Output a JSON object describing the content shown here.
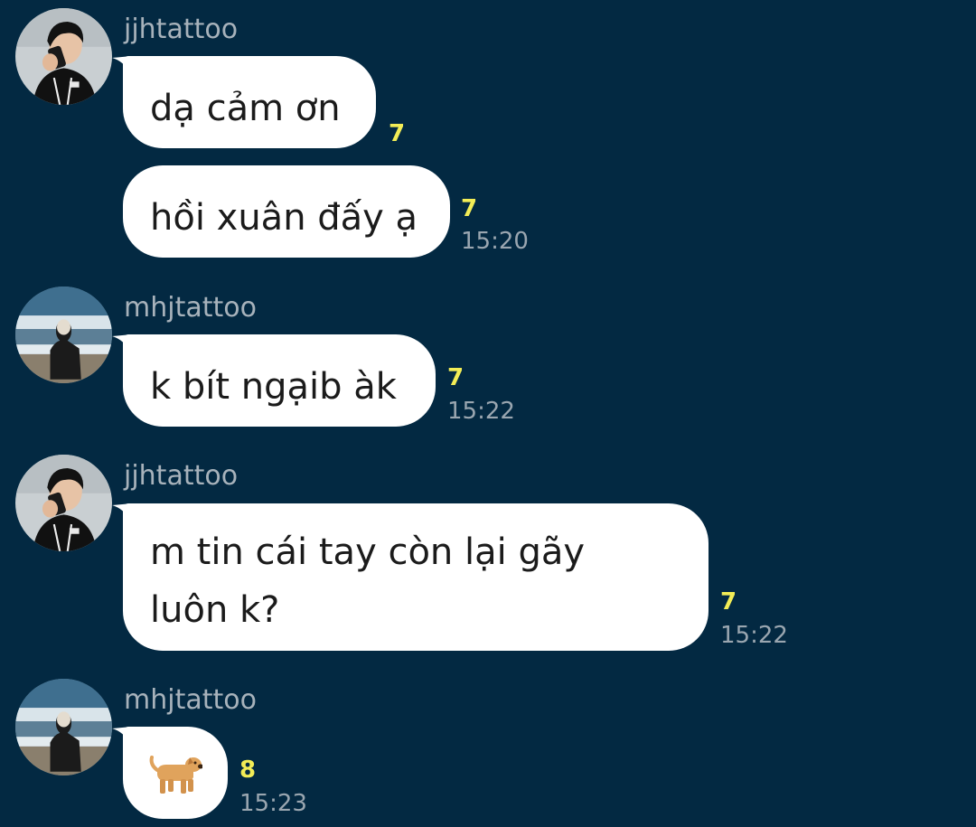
{
  "colors": {
    "background": "#032942",
    "bubble": "#ffffff",
    "sender_name": "#a7b2bb",
    "unread_count": "#f3ed56",
    "timestamp": "#9aa6b0"
  },
  "groups": [
    {
      "sender": "jjhtattoo",
      "avatar": "jjhtattoo-avatar",
      "messages": [
        {
          "text": "dạ cảm ơn",
          "unread": "7"
        },
        {
          "text": "hồi xuân đấy ạ",
          "unread": "7",
          "time": "15:20"
        }
      ]
    },
    {
      "sender": "mhjtattoo",
      "avatar": "mhjtattoo-avatar",
      "messages": [
        {
          "text": "k bít ngạib àk",
          "unread": "7",
          "time": "15:22"
        }
      ]
    },
    {
      "sender": "jjhtattoo",
      "avatar": "jjhtattoo-avatar",
      "messages": [
        {
          "lines": [
            "m tin cái tay còn lại gãy",
            "luôn k?"
          ],
          "unread": "7",
          "time": "15:22"
        }
      ]
    },
    {
      "sender": "mhjtattoo",
      "avatar": "mhjtattoo-avatar",
      "messages": [
        {
          "sticker": "dog-emoji",
          "unread": "8",
          "time": "15:23"
        }
      ]
    }
  ]
}
